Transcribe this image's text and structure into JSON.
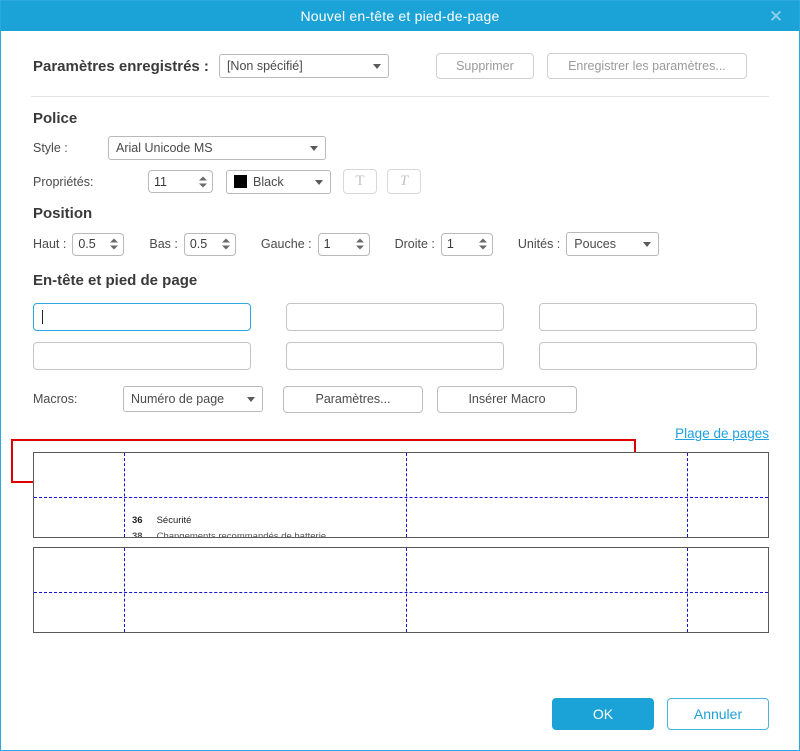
{
  "titlebar": {
    "title": "Nouvel en-tête et pied-de-page",
    "close_icon": "close-icon",
    "close_glyph": "✕",
    "bg_color": "#1ba3d8"
  },
  "saved_settings": {
    "label": "Paramètres enregistrés :",
    "dropdown_value": "[Non spécifié]",
    "delete_button": "Supprimer",
    "save_button": "Enregistrer les paramètres..."
  },
  "font_section": {
    "heading": "Police",
    "style_label": "Style :",
    "style_value": "Arial Unicode MS",
    "properties_label": "Propriétés:",
    "size_value": "11",
    "color_value": "Black",
    "color_hex": "#000000",
    "bold_button": "T",
    "italic_button": "T"
  },
  "position_section": {
    "heading": "Position",
    "top_label": "Haut :",
    "top_value": "0.5",
    "bottom_label": "Bas :",
    "bottom_value": "0.5",
    "left_label": "Gauche :",
    "left_value": "1",
    "right_label": "Droite :",
    "right_value": "1",
    "units_label": "Unités :",
    "units_value": "Pouces"
  },
  "header_footer_section": {
    "heading": "En-tête et pied de page",
    "fields": [
      {
        "value": "",
        "placeholder": ""
      },
      {
        "value": "",
        "placeholder": ""
      },
      {
        "value": "",
        "placeholder": ""
      },
      {
        "value": "",
        "placeholder": ""
      },
      {
        "value": "",
        "placeholder": ""
      },
      {
        "value": "",
        "placeholder": ""
      }
    ]
  },
  "macros": {
    "label": "Macros:",
    "dropdown_value": "Numéro de page",
    "settings_button": "Paramètres...",
    "insert_button": "Insérer Macro",
    "highlight_color": "#e00000"
  },
  "page_range": {
    "link_text": "Plage de pages",
    "link_color": "#20a0e0"
  },
  "preview": {
    "page_one": {
      "line_number": "36",
      "line_text": "Sécurité"
    },
    "guide_color": "#1414d0"
  },
  "footer": {
    "ok_button": "OK",
    "cancel_button": "Annuler",
    "ok_color": "#1ba3d8"
  }
}
